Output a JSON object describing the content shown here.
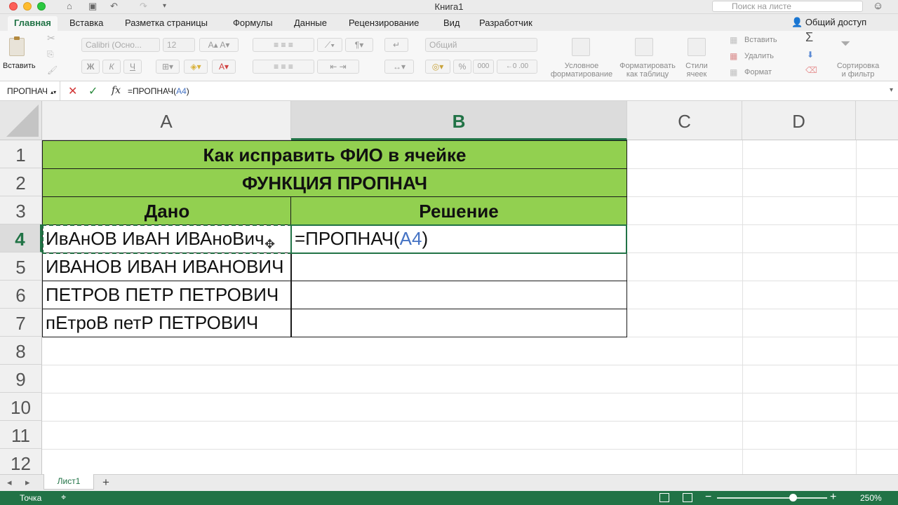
{
  "window": {
    "title": "Книга1",
    "search_placeholder": "Поиск на листе"
  },
  "ribbon_tabs": [
    "Главная",
    "Вставка",
    "Разметка страницы",
    "Формулы",
    "Данные",
    "Рецензирование",
    "Вид",
    "Разработчик"
  ],
  "share_label": "Общий доступ",
  "ribbon": {
    "paste_label": "Вставить",
    "font_name": "Calibri (Осно...",
    "font_size": "12",
    "bold": "Ж",
    "italic": "К",
    "underline": "Ч",
    "number_format": "Общий",
    "percent": "%",
    "thousands": "000",
    "cond_format_label": "Условное\nформатирование",
    "format_table_label": "Форматировать\nкак таблицу",
    "cell_styles_label": "Стили\nячеек",
    "insert_label": "Вставить",
    "delete_label": "Удалить",
    "format_label": "Формат",
    "sort_filter_label": "Сортировка\nи фильтр"
  },
  "formula_bar": {
    "name_box": "ПРОПНАЧ",
    "fx": "fx",
    "formula_prefix": "=ПРОПНАЧ(",
    "formula_ref": "A4",
    "formula_suffix": ")"
  },
  "columns": [
    "A",
    "B",
    "C",
    "D"
  ],
  "rows": [
    "1",
    "2",
    "3",
    "4",
    "5",
    "6",
    "7",
    "8",
    "9",
    "10",
    "11",
    "12"
  ],
  "cells": {
    "title": "Как исправить ФИО в ячейке",
    "subtitle": "ФУНКЦИЯ ПРОПНАЧ",
    "header_given": "Дано",
    "header_solution": "Решение",
    "a4": "ИвАнОВ ИвАН ИВАноВич",
    "a5": "ИВАНОВ ИВАН ИВАНОВИЧ",
    "a6": "ПЕТРОВ ПЕТР ПЕТРОВИЧ",
    "a7": "пЕтроВ петР ПЕТРОВИЧ"
  },
  "sheet": {
    "tab": "Лист1",
    "add": "+"
  },
  "status": {
    "mode": "Точка",
    "zoom": "250%",
    "zoom_level": 2.5
  }
}
